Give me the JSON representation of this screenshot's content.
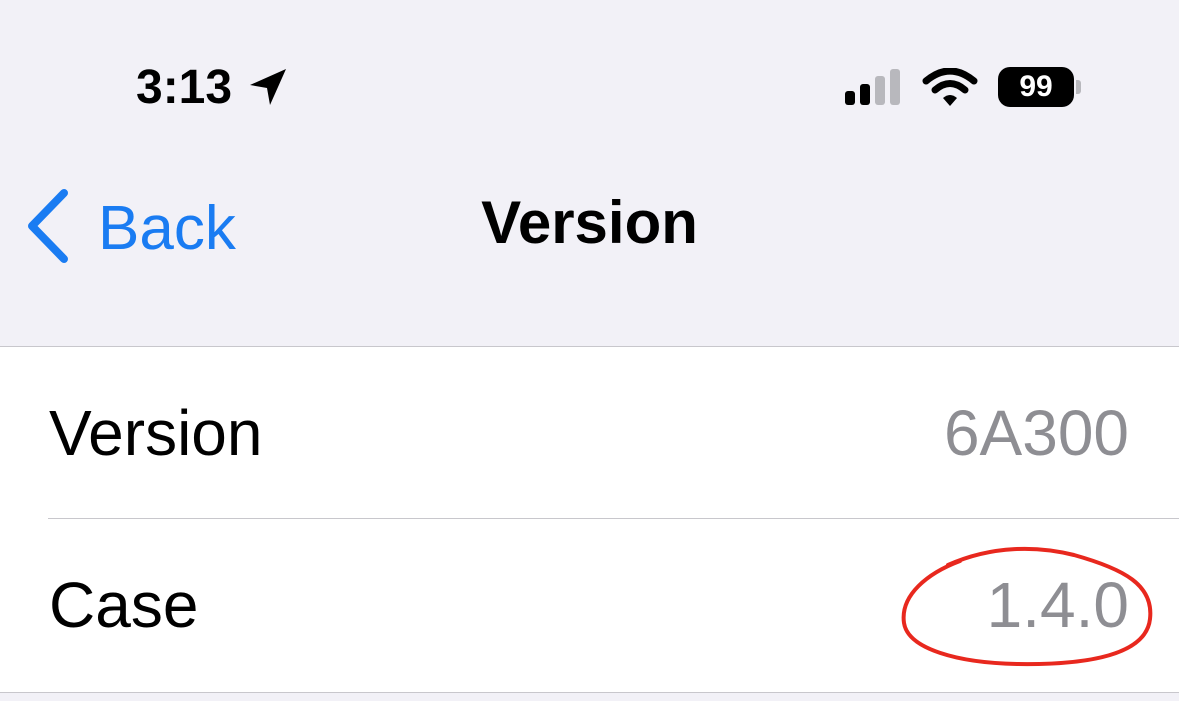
{
  "status_bar": {
    "time": "3:13",
    "location_icon": "location-arrow-icon",
    "signal_icon": "cellular-signal-icon",
    "wifi_icon": "wifi-icon",
    "battery_level": "99"
  },
  "nav": {
    "back_label": "Back",
    "title": "Version"
  },
  "rows": [
    {
      "label": "Version",
      "value": "6A300"
    },
    {
      "label": "Case",
      "value": "1.4.0"
    }
  ],
  "annotation": {
    "shape": "hand-drawn red ellipse",
    "color": "#e8281e",
    "target": "rows.1.value"
  },
  "colors": {
    "accent": "#1a7cf2",
    "background": "#f2f1f7",
    "secondary_text": "#8e8e93"
  }
}
